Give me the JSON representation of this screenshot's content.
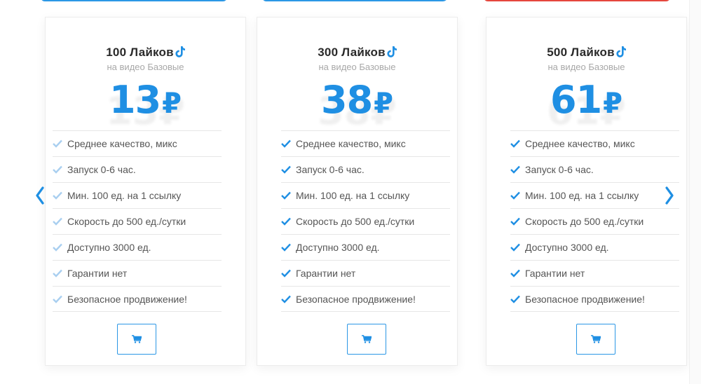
{
  "theme": {
    "accent": "#1f8fe3",
    "check_color_faded": "#a9cff0",
    "check_color": "#1f8fe3",
    "top_button_blue": "#2b97e5",
    "top_button_red": "#e5473d"
  },
  "carousel": {
    "prev_icon": "chevron-left-icon",
    "next_icon": "chevron-right-icon"
  },
  "cards": [
    {
      "title": "100 Лайков",
      "platform_icon": "tiktok-icon",
      "subtitle": "на видео Базовые",
      "price": "13",
      "currency": "₽",
      "features": [
        "Среднее качество, микс",
        "Запуск 0-6 час.",
        "Мин. 100 ед. на 1 ссылку",
        "Скорость до 500 ед./сутки",
        "Доступно 3000 ед.",
        "Гарантии нет",
        "Безопасное продвижение!"
      ],
      "cart_icon": "cart-icon"
    },
    {
      "title": "300 Лайков",
      "platform_icon": "tiktok-icon",
      "subtitle": "на видео Базовые",
      "price": "38",
      "currency": "₽",
      "features": [
        "Среднее качество, микс",
        "Запуск 0-6 час.",
        "Мин. 100 ед. на 1 ссылку",
        "Скорость до 500 ед./сутки",
        "Доступно 3000 ед.",
        "Гарантии нет",
        "Безопасное продвижение!"
      ],
      "cart_icon": "cart-icon"
    },
    {
      "title": "500 Лайков",
      "platform_icon": "tiktok-icon",
      "subtitle": "на видео Базовые",
      "price": "61",
      "currency": "₽",
      "features": [
        "Среднее качество, микс",
        "Запуск 0-6 час.",
        "Мин. 100 ед. на 1 ссылку",
        "Скорость до 500 ед./сутки",
        "Доступно 3000 ед.",
        "Гарантии нет",
        "Безопасное продвижение!"
      ],
      "cart_icon": "cart-icon"
    }
  ]
}
